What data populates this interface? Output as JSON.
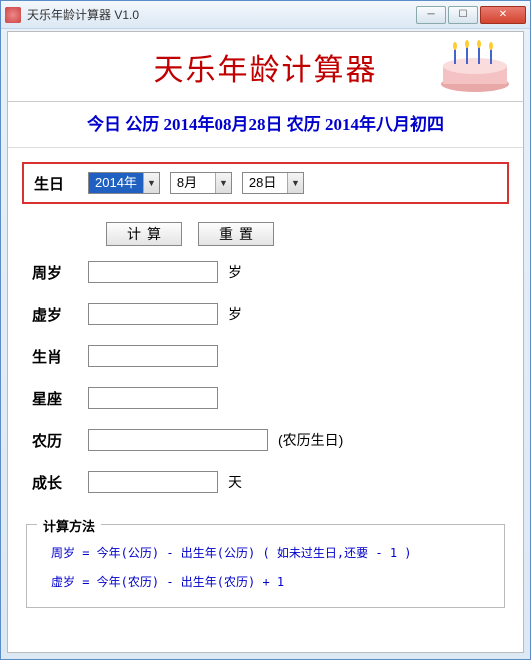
{
  "window": {
    "title": "天乐年龄计算器 V1.0"
  },
  "header": {
    "app_title": "天乐年龄计算器",
    "today_line": "今日 公历 2014年08月28日 农历 2014年八月初四"
  },
  "birthday": {
    "label": "生日",
    "year": "2014年",
    "month": "8月",
    "day": "28日"
  },
  "buttons": {
    "calc": "计算",
    "reset": "重置"
  },
  "fields": {
    "zhousui": {
      "label": "周岁",
      "value": "",
      "unit": "岁"
    },
    "xusui": {
      "label": "虚岁",
      "value": "",
      "unit": "岁"
    },
    "shengxiao": {
      "label": "生肖",
      "value": ""
    },
    "xingzuo": {
      "label": "星座",
      "value": ""
    },
    "nongli": {
      "label": "农历",
      "value": "",
      "note": "(农历生日)"
    },
    "chengzhang": {
      "label": "成长",
      "value": "",
      "unit": "天"
    }
  },
  "method": {
    "title": "计算方法",
    "line1": "周岁 =  今年(公历)  -  出生年(公历)  ( 如未过生日,还要 - 1 )",
    "line2": "虚岁 =  今年(农历)  -  出生年(农历)  + 1"
  }
}
